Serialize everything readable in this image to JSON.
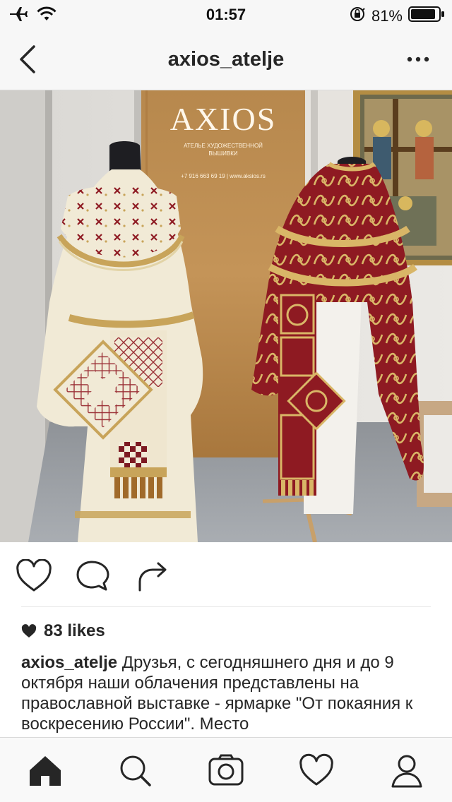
{
  "status_bar": {
    "time": "01:57",
    "battery": "81%",
    "icons": [
      "airplane-icon",
      "wifi-icon",
      "orientation-lock-icon",
      "battery-icon"
    ]
  },
  "nav": {
    "title": "axios_atelje",
    "back_icon": "chevron-left-icon",
    "more_icon": "more-icon"
  },
  "photo": {
    "banner_brand": "AXIOS",
    "banner_subtitle_line1": "АТЕЛЬЕ ХУДОЖЕСТВЕННОЙ",
    "banner_subtitle_line2": "ВЫШИВКИ",
    "banner_contacts": "+7 916 663 69 19  |  www.aksios.rs"
  },
  "actions": {
    "icons": [
      "heart-icon",
      "comment-icon",
      "share-icon"
    ]
  },
  "post": {
    "likes": "83 likes",
    "caption_user": "axios_atelje",
    "caption_text": "Друзья,  с сегодняшнего дня и до 9 октября наши облачения представлены на православной выставке - ярмарке \"От покаяния к воскресению России\". Место"
  },
  "tab_bar": {
    "icons": [
      "home-icon",
      "search-icon",
      "camera-icon",
      "activity-heart-icon",
      "profile-icon"
    ]
  },
  "colors": {
    "header_bg": "#f7f7f7",
    "text": "#262626",
    "vestment_red": "#8e1a22",
    "vestment_gold": "#c8a45a",
    "vestment_cream": "#f1ead6"
  }
}
